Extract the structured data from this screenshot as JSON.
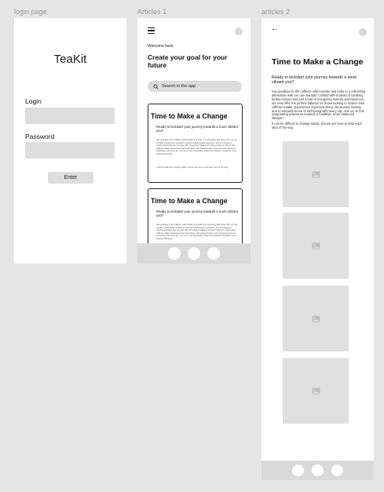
{
  "frame_labels": {
    "login": "login page",
    "articles1": "Articles 1",
    "articles2": "articles 2"
  },
  "login": {
    "brand": "TeaKit",
    "login_label": "Login",
    "password_label": "Password",
    "enter_button": "Enter"
  },
  "articles1": {
    "menu_icon": "hamburger-icon",
    "welcome": "Welcome back",
    "goal_heading": "Create your goal for your future",
    "search_placeholder": "Search in the app",
    "search_icon": "search-icon",
    "cards": [
      {
        "title": "Time to Make a Change",
        "subtitle": "Ready to kickstart your journey towards a more vibrant you?",
        "body": "Say goodbye to the caffeine rollercoaster and hello to a refreshing alternative with our one tea Bar! Crafted with a blend of soothing herbal tisanes and just a hint of energizing matcha and black tea, our teas offer the perfect balance for those looking to reduce their caffeine intake. Experience improved sleep, decreased anxiety, and a renewed sense of well-being with every sip. Join us on this invigorating adventure towards a healthier, more balanced lifestyle!",
        "body2": "It can be difficult to change habits, but we are here to help each step of the way."
      },
      {
        "title": "Time to Make a Change",
        "subtitle": "Ready to kickstart your journey towards a more vibrant you?",
        "body": "Say goodbye to the caffeine rollercoaster and hello to a refreshing alternative with our one tea Bar! Crafted with a blend of soothing herbal tisanes and just a hint of energizing matcha and black tea, our teas offer the perfect balance for those looking to reduce their caffeine intake. Experience improved sleep, decreased anxiety, and a renewed sense of well-being with every sip. Join us on this invigorating adventure towards a healthier, more balanced lifestyle!",
        "body2": ""
      }
    ]
  },
  "articles2": {
    "back_icon": "back-arrow-icon",
    "back_glyph": "←",
    "title": "Time to Make a Change",
    "subtitle": "Ready to kickstart your journey towards a more vibrant you?",
    "body": "Say goodbye to the caffeine rollercoaster and hello to a refreshing alternative with our one tea Bar! Crafted with a blend of soothing herbal tisanes and just a hint of energizing matcha and black tea, our teas offer the perfect balance for those looking to reduce their caffeine intake. Experience improved sleep, decreased anxiety, and a renewed sense of well-being with every sip. Join us on this invigorating adventure towards a healthier, more balanced lifestyle!",
    "body2": "It can be difficult to change habits, but we are here to help each step of the way.",
    "image_icon": "image-placeholder-icon"
  },
  "colors": {
    "canvas": "#e5e5e5",
    "frame": "#ffffff",
    "field": "#dedede",
    "bar": "#d9d9d9"
  }
}
